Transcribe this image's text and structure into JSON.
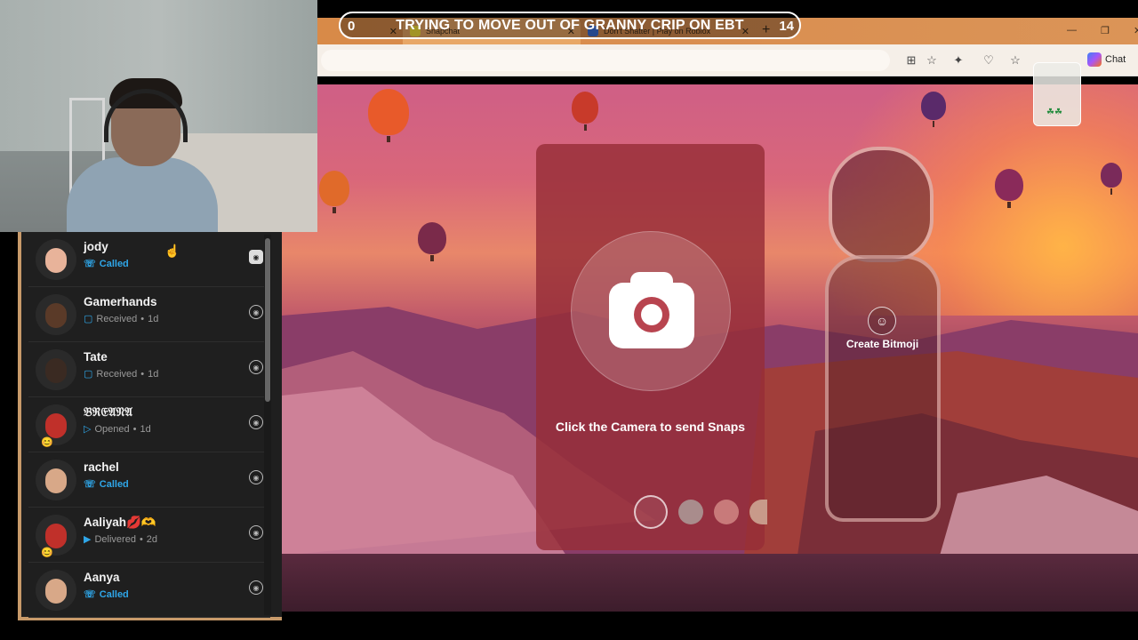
{
  "browser": {
    "tabs": [
      {
        "label": ""
      },
      {
        "label": "Snapchat"
      },
      {
        "label": "Don't Shatter | Play on Roblox"
      }
    ],
    "chat_label": "Chat"
  },
  "overlay": {
    "left_count": "0",
    "title": "TRYING TO MOVE OUT OF GRANNY CRIP ON EBT",
    "right_count": "14"
  },
  "camera_card": {
    "prompt": "Click the Camera to send Snaps"
  },
  "bitmoji": {
    "label": "Create Bitmoji"
  },
  "chats": [
    {
      "name": "jody",
      "status": "Called",
      "time": "",
      "type": "called"
    },
    {
      "name": "Gamerhands",
      "status": "Received",
      "time": "1d",
      "type": "received"
    },
    {
      "name": "Tate",
      "status": "Received",
      "time": "1d",
      "type": "received"
    },
    {
      "name": "𝔅ℜ𝔈𝔄𝔑𝔄",
      "status": "Opened",
      "time": "1d",
      "type": "opened"
    },
    {
      "name": "rachel",
      "status": "Called",
      "time": "",
      "type": "called"
    },
    {
      "name": "Aaliyah💋🫶",
      "status": "Delivered",
      "time": "2d",
      "type": "delivered"
    },
    {
      "name": "Aanya",
      "status": "Called",
      "time": "",
      "type": "called"
    }
  ],
  "colors": {
    "called": "#2fa6e8",
    "panel_bg": "#1f1f1f",
    "frame_border": "#c89a6a"
  }
}
